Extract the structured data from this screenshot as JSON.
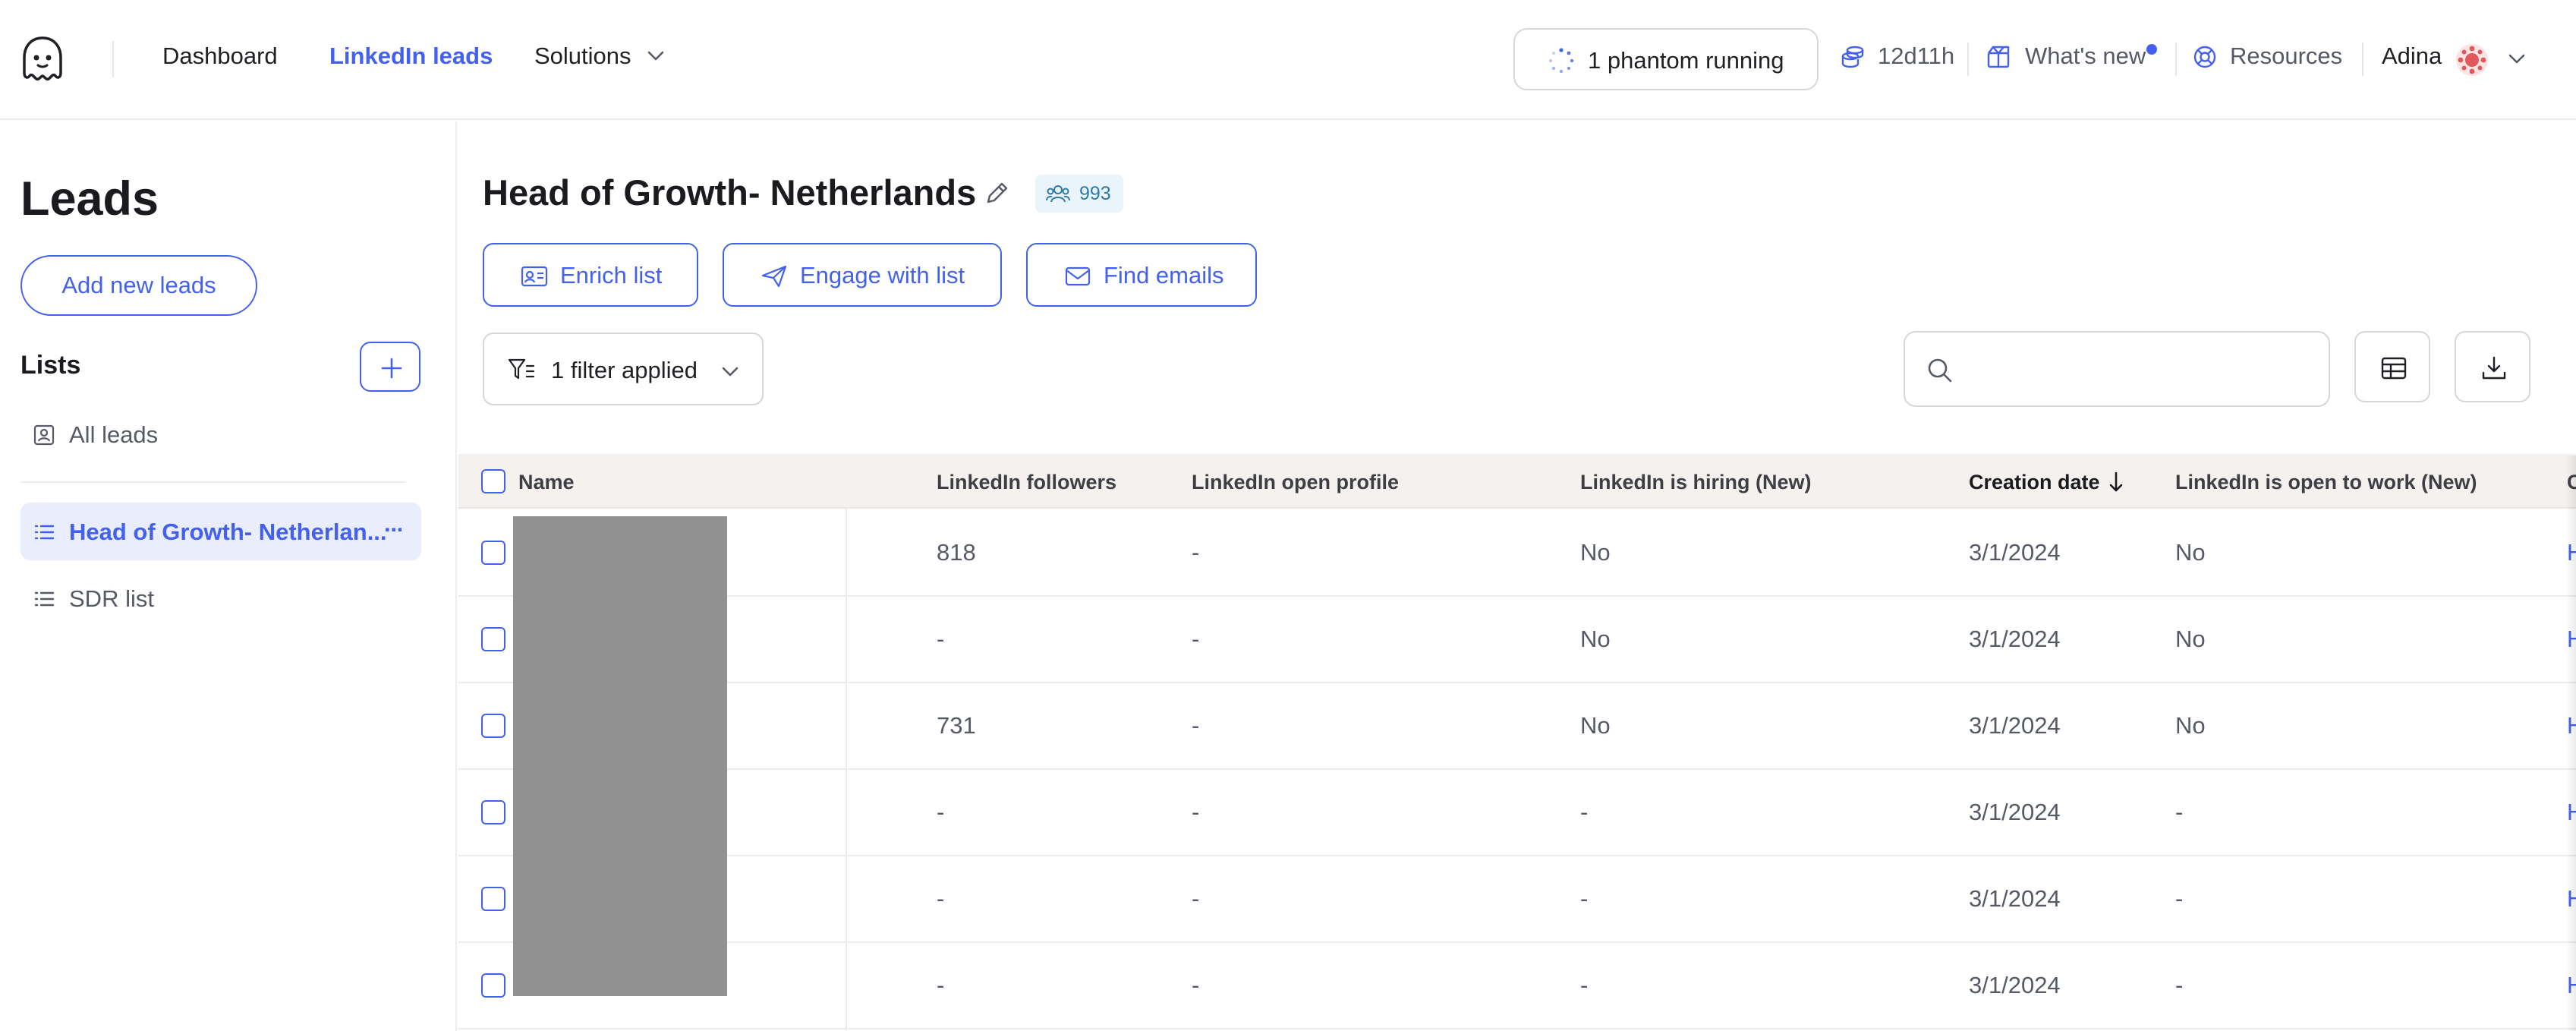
{
  "nav": {
    "dashboard": "Dashboard",
    "linkedin_leads": "LinkedIn leads",
    "solutions": "Solutions",
    "phantom_status": "1 phantom running",
    "time_remaining": "12d11h",
    "whats_new": "What's new",
    "resources": "Resources",
    "user_name": "Adina"
  },
  "sidebar": {
    "title": "Leads",
    "add_leads_label": "Add new leads",
    "lists_heading": "Lists",
    "items": [
      {
        "label": "All leads",
        "icon": "contact-card-icon"
      },
      {
        "label": "Head of Growth- Netherlan...",
        "icon": "list-icon",
        "active": true,
        "more": "···"
      },
      {
        "label": "SDR list",
        "icon": "list-icon"
      }
    ]
  },
  "main": {
    "title": "Head of Growth- Netherlands",
    "count": "993",
    "actions": {
      "enrich": "Enrich list",
      "engage": "Engage with list",
      "find_emails": "Find emails"
    },
    "filter_label": "1 filter applied",
    "search_placeholder": ""
  },
  "table": {
    "columns": [
      "Name",
      "LinkedIn followers",
      "LinkedIn open profile",
      "LinkedIn is hiring (New)",
      "Creation date",
      "LinkedIn is open to work (New)",
      "C"
    ],
    "rows": [
      {
        "followers": "818",
        "open_profile": "-",
        "is_hiring": "No",
        "creation_date": "3/1/2024",
        "open_to_work": "No",
        "next": "H"
      },
      {
        "followers": "-",
        "open_profile": "-",
        "is_hiring": "No",
        "creation_date": "3/1/2024",
        "open_to_work": "No",
        "next": "H"
      },
      {
        "followers": "731",
        "open_profile": "-",
        "is_hiring": "No",
        "creation_date": "3/1/2024",
        "open_to_work": "No",
        "next": "H"
      },
      {
        "followers": "-",
        "open_profile": "-",
        "is_hiring": "-",
        "creation_date": "3/1/2024",
        "open_to_work": "-",
        "next": "H"
      },
      {
        "followers": "-",
        "open_profile": "-",
        "is_hiring": "-",
        "creation_date": "3/1/2024",
        "open_to_work": "-",
        "next": "H"
      },
      {
        "followers": "-",
        "open_profile": "-",
        "is_hiring": "-",
        "creation_date": "3/1/2024",
        "open_to_work": "-",
        "next": "H"
      }
    ]
  },
  "colors": {
    "accent": "#4361ee",
    "header_bg": "#f5f1ee",
    "active_item_bg": "#eaeefc",
    "badge_bg": "#e9f5fa",
    "redaction": "#919191"
  }
}
